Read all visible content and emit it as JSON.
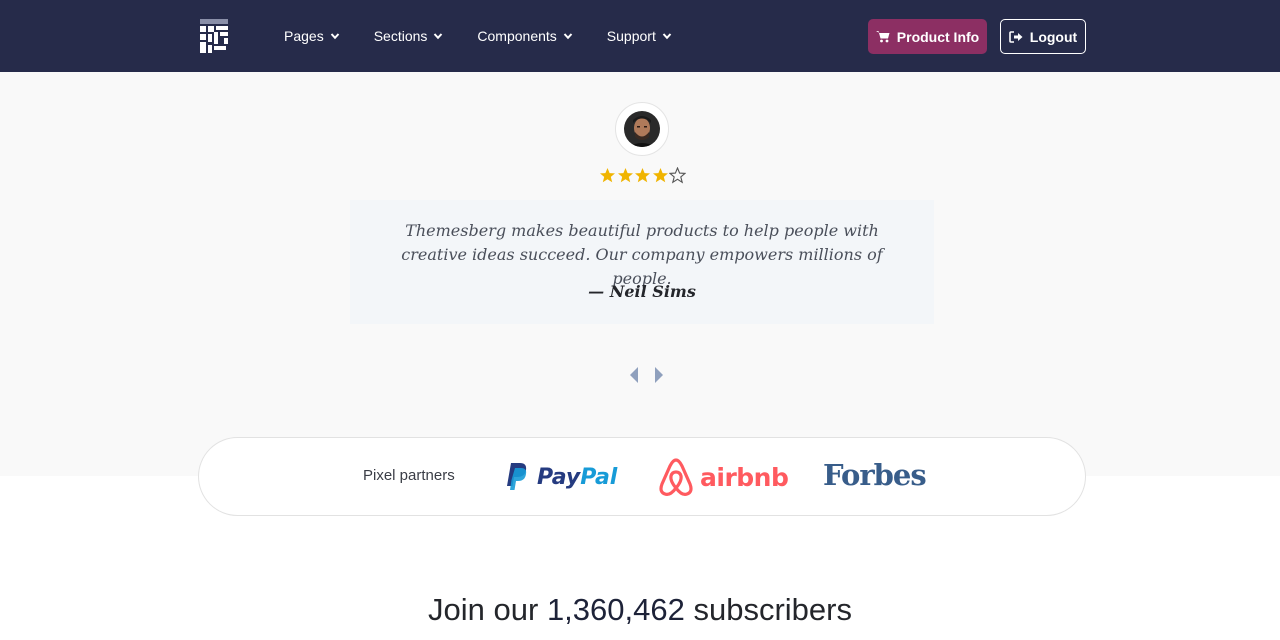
{
  "nav": {
    "items": [
      {
        "label": "Pages"
      },
      {
        "label": "Sections"
      },
      {
        "label": "Components"
      },
      {
        "label": "Support"
      }
    ],
    "product_button": "Product Info",
    "logout_button": "Logout"
  },
  "testimonial": {
    "rating": 4,
    "rating_max": 5,
    "quote": "Themesberg makes beautiful products to help people with creative ideas succeed. Our company empowers millions of people.",
    "author": "— Neil Sims"
  },
  "partners": {
    "label": "Pixel partners",
    "logos": [
      {
        "name": "paypal",
        "text_a": "Pay",
        "text_b": "Pal"
      },
      {
        "name": "airbnb",
        "text": "airbnb"
      },
      {
        "name": "forbes",
        "text": "Forbes"
      }
    ]
  },
  "subscribers": {
    "prefix": "Join our",
    "count": "1,360,462",
    "suffix": "subscribers"
  },
  "colors": {
    "navbar": "#262b4a",
    "product_button": "#8c2f63",
    "star": "#f0b400",
    "section_bg": "#f9f9f9",
    "quote_bg": "#f3f6f9"
  }
}
